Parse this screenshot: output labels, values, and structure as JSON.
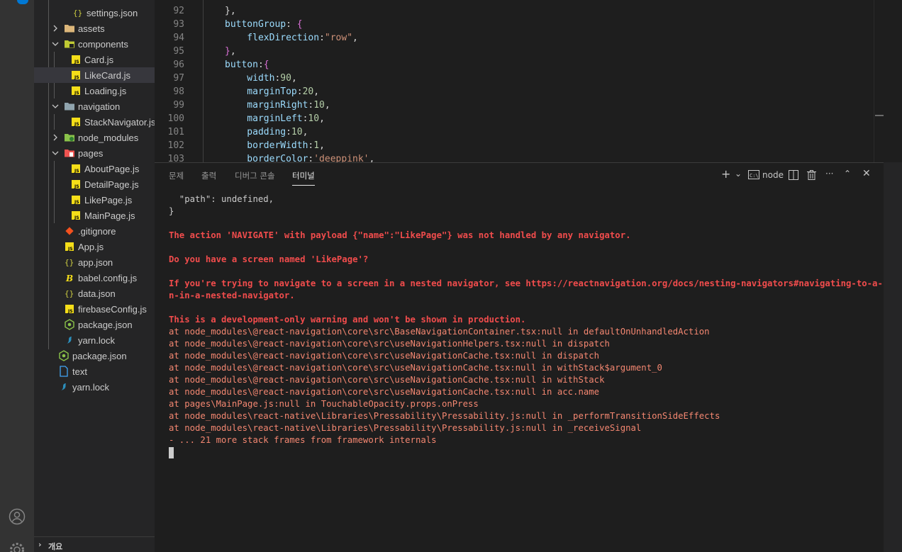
{
  "colors": {
    "activity_bg": "#333333",
    "sidebar_bg": "#252526",
    "editor_bg": "#1e1e1e",
    "selection_bg": "#37373d",
    "error_red": "#f14c4c",
    "stack_red": "#f48771",
    "json_yellow": "#cbcb41",
    "js_yellow": "#f5de19"
  },
  "sidebar": {
    "items": [
      {
        "label": "settings.json",
        "icon": "json-braces-icon"
      },
      {
        "label": "assets",
        "icon": "folder-icon",
        "chevron": "chevron-right-icon"
      },
      {
        "label": "components",
        "icon": "folder-components-icon",
        "chevron": "chevron-down-icon"
      },
      {
        "label": "Card.js",
        "icon": "js-file-icon"
      },
      {
        "label": "LikeCard.js",
        "icon": "js-file-icon"
      },
      {
        "label": "Loading.js",
        "icon": "js-file-icon"
      },
      {
        "label": "navigation",
        "icon": "folder-open-icon",
        "chevron": "chevron-down-icon"
      },
      {
        "label": "StackNavigator.js",
        "icon": "js-file-icon"
      },
      {
        "label": "node_modules",
        "icon": "folder-node-icon",
        "chevron": "chevron-right-icon"
      },
      {
        "label": "pages",
        "icon": "folder-pages-icon",
        "chevron": "chevron-down-icon"
      },
      {
        "label": "AboutPage.js",
        "icon": "js-file-icon"
      },
      {
        "label": "DetailPage.js",
        "icon": "js-file-icon"
      },
      {
        "label": "LikePage.js",
        "icon": "js-file-icon"
      },
      {
        "label": "MainPage.js",
        "icon": "js-file-icon"
      },
      {
        "label": ".gitignore",
        "icon": "git-icon"
      },
      {
        "label": "App.js",
        "icon": "js-file-icon"
      },
      {
        "label": "app.json",
        "icon": "json-braces-icon"
      },
      {
        "label": "babel.config.js",
        "icon": "babel-icon"
      },
      {
        "label": "data.json",
        "icon": "json-braces-icon"
      },
      {
        "label": "firebaseConfig.js",
        "icon": "js-file-icon"
      },
      {
        "label": "package.json",
        "icon": "node-package-icon"
      },
      {
        "label": "yarn.lock",
        "icon": "yarn-icon"
      },
      {
        "label": "package.json",
        "icon": "node-package-icon"
      },
      {
        "label": "text",
        "icon": "text-file-icon"
      },
      {
        "label": "yarn.lock",
        "icon": "yarn-icon"
      }
    ],
    "outline_label": "개요"
  },
  "editor": {
    "lines": [
      {
        "n": "92",
        "tokens": [
          [
            "punc",
            "},"
          ]
        ]
      },
      {
        "n": "93",
        "tokens": [
          [
            "prop",
            "buttonGroup"
          ],
          [
            "punc",
            ": "
          ],
          [
            "brace",
            "{"
          ]
        ]
      },
      {
        "n": "94",
        "tokens": [
          [
            "prop",
            "    flexDirection"
          ],
          [
            "punc",
            ":"
          ],
          [
            "str",
            "\"row\""
          ],
          [
            "punc",
            ","
          ]
        ]
      },
      {
        "n": "95",
        "tokens": [
          [
            "brace",
            "}"
          ],
          [
            "punc",
            ","
          ]
        ]
      },
      {
        "n": "96",
        "tokens": [
          [
            "prop",
            "button"
          ],
          [
            "punc",
            ":"
          ],
          [
            "brace",
            "{"
          ]
        ]
      },
      {
        "n": "97",
        "tokens": [
          [
            "prop",
            "    width"
          ],
          [
            "punc",
            ":"
          ],
          [
            "num",
            "90"
          ],
          [
            "punc",
            ","
          ]
        ]
      },
      {
        "n": "98",
        "tokens": [
          [
            "prop",
            "    marginTop"
          ],
          [
            "punc",
            ":"
          ],
          [
            "num",
            "20"
          ],
          [
            "punc",
            ","
          ]
        ]
      },
      {
        "n": "99",
        "tokens": [
          [
            "prop",
            "    marginRight"
          ],
          [
            "punc",
            ":"
          ],
          [
            "num",
            "10"
          ],
          [
            "punc",
            ","
          ]
        ]
      },
      {
        "n": "100",
        "tokens": [
          [
            "prop",
            "    marginLeft"
          ],
          [
            "punc",
            ":"
          ],
          [
            "num",
            "10"
          ],
          [
            "punc",
            ","
          ]
        ]
      },
      {
        "n": "101",
        "tokens": [
          [
            "prop",
            "    padding"
          ],
          [
            "punc",
            ":"
          ],
          [
            "num",
            "10"
          ],
          [
            "punc",
            ","
          ]
        ]
      },
      {
        "n": "102",
        "tokens": [
          [
            "prop",
            "    borderWidth"
          ],
          [
            "punc",
            ":"
          ],
          [
            "num",
            "1"
          ],
          [
            "punc",
            ","
          ]
        ]
      },
      {
        "n": "103",
        "tokens": [
          [
            "prop",
            "    borderColor"
          ],
          [
            "punc",
            ":"
          ],
          [
            "str",
            "'deeppink'"
          ],
          [
            "punc",
            ","
          ]
        ]
      }
    ]
  },
  "panel": {
    "tabs": [
      "문제",
      "출력",
      "디버그 콘솔",
      "터미널"
    ],
    "active_tab": "터미널",
    "terminal_name": "node",
    "terminal_lines": [
      {
        "style": "white",
        "text": "  \"path\": undefined,"
      },
      {
        "style": "white",
        "text": "}"
      },
      {
        "style": "blank",
        "text": ""
      },
      {
        "style": "red",
        "text": "The action 'NAVIGATE' with payload {\"name\":\"LikePage\"} was not handled by any navigator."
      },
      {
        "style": "blank",
        "text": ""
      },
      {
        "style": "red",
        "text": "Do you have a screen named 'LikePage'?"
      },
      {
        "style": "blank",
        "text": ""
      },
      {
        "style": "red",
        "text": "If you're trying to navigate to a screen in a nested navigator, see https://reactnavigation.org/docs/nesting-navigators#navigating-to-a-scree"
      },
      {
        "style": "red",
        "text": "n-in-a-nested-navigator."
      },
      {
        "style": "blank",
        "text": ""
      },
      {
        "style": "red",
        "text": "This is a development-only warning and won't be shown in production."
      },
      {
        "style": "redn",
        "text": "at node_modules\\@react-navigation\\core\\src\\BaseNavigationContainer.tsx:null in defaultOnUnhandledAction"
      },
      {
        "style": "redn",
        "text": "at node_modules\\@react-navigation\\core\\src\\useNavigationHelpers.tsx:null in dispatch"
      },
      {
        "style": "redn",
        "text": "at node_modules\\@react-navigation\\core\\src\\useNavigationCache.tsx:null in dispatch"
      },
      {
        "style": "redn",
        "text": "at node_modules\\@react-navigation\\core\\src\\useNavigationCache.tsx:null in withStack$argument_0"
      },
      {
        "style": "redn",
        "text": "at node_modules\\@react-navigation\\core\\src\\useNavigationCache.tsx:null in withStack"
      },
      {
        "style": "redn",
        "text": "at node_modules\\@react-navigation\\core\\src\\useNavigationCache.tsx:null in acc.name"
      },
      {
        "style": "redn",
        "text": "at pages\\MainPage.js:null in TouchableOpacity.props.onPress"
      },
      {
        "style": "redn",
        "text": "at node_modules\\react-native\\Libraries\\Pressability\\Pressability.js:null in _performTransitionSideEffects"
      },
      {
        "style": "redn",
        "text": "at node_modules\\react-native\\Libraries\\Pressability\\Pressability.js:null in _receiveSignal"
      },
      {
        "style": "redn",
        "text": "- ... 21 more stack frames from framework internals"
      }
    ]
  }
}
